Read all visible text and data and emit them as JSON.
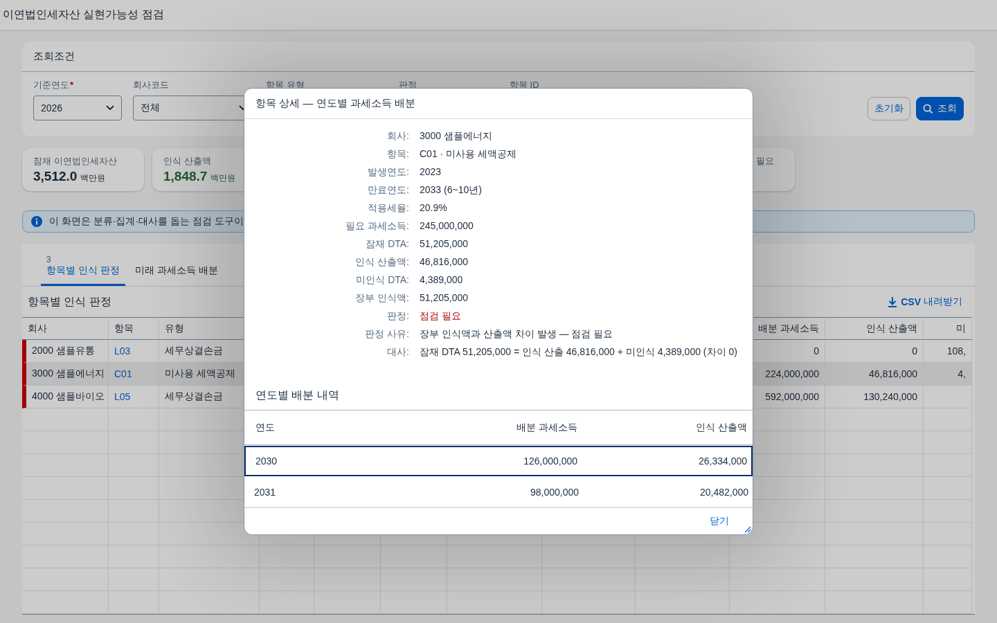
{
  "page_title": "이연법인세자산 실현가능성 점검",
  "filter_panel": {
    "title": "조회조건",
    "required_mark": "*",
    "fields": [
      {
        "label": "기준연도",
        "required": true,
        "value": "2026"
      },
      {
        "label": "회사코드",
        "required": false,
        "value": "전체"
      },
      {
        "label": "항목 유형",
        "required": false
      },
      {
        "label": "판정",
        "required": false
      },
      {
        "label": "항목 ID",
        "required": false
      }
    ],
    "buttons": [
      {
        "label": "초기화",
        "kind": "secondary"
      },
      {
        "label": "조회",
        "kind": "primary"
      }
    ]
  },
  "kpi_cards": [
    {
      "label": "잠재 이연법인세자산",
      "value": "3,512.0",
      "unit": "백만원",
      "kind": "neutral"
    },
    {
      "label": "인식 산출액",
      "value": "1,848.7",
      "unit": "백만원",
      "kind": "positive"
    },
    {
      "label": "필요",
      "kind": "clipped"
    }
  ],
  "info_banner": "이 화면은 분류·집계·대사를 돕는 점검 도구이",
  "tabs": [
    {
      "count": "3",
      "label": "항목별 인식 판정",
      "selected": true
    },
    {
      "label": "미래 과세소득 배분",
      "selected": false
    }
  ],
  "table": {
    "title": "항목별 인식 판정",
    "download_link": "CSV 내려받기",
    "columns": {
      "company": "회사",
      "item": "항목",
      "type": "유형",
      "allocated_income": "배분 과세소득",
      "recognized_amount": "인식 산출액",
      "column_12": "미"
    },
    "rows": [
      {
        "company": "2000 샘플유통",
        "item": "L03",
        "type": "세무상결손금",
        "allocated_income": "0",
        "recognized_amount": "0",
        "column_12": "108,",
        "flagged": true,
        "selected": false
      },
      {
        "company": "3000 샘플에너지",
        "item": "C01",
        "type": "미사용 세액공제",
        "allocated_income": "224,000,000",
        "recognized_amount": "46,816,000",
        "column_12": "4,",
        "flagged": true,
        "selected": true
      },
      {
        "company": "4000 샘플바이오",
        "item": "L05",
        "type": "세무상결손금",
        "allocated_income": "592,000,000",
        "recognized_amount": "130,240,000",
        "flagged": true,
        "selected": false
      }
    ]
  },
  "dialog": {
    "title": "항목 상세 — 연도별 과세소득 배분",
    "details": [
      {
        "label": "회사:",
        "value": "3000 샘플에너지",
        "kind": "text"
      },
      {
        "label": "항목:",
        "value": "C01 · 미사용 세액공제",
        "kind": "text"
      },
      {
        "label": "발생연도:",
        "value": "2023",
        "kind": "text"
      },
      {
        "label": "만료연도:",
        "value": "2033 (6~10년)",
        "kind": "text"
      },
      {
        "label": "적용세율:",
        "value": "20.9%",
        "kind": "text"
      },
      {
        "label": "필요 과세소득:",
        "value": "245,000,000",
        "kind": "text"
      },
      {
        "label": "잠재 DTA:",
        "value": "51,205,000",
        "kind": "text"
      },
      {
        "label": "인식 산출액:",
        "value": "46,816,000",
        "kind": "text"
      },
      {
        "label": "미인식 DTA:",
        "value": "4,389,000",
        "kind": "text"
      },
      {
        "label": "장부 인식액:",
        "value": "51,205,000",
        "kind": "text"
      },
      {
        "label": "판정:",
        "value": "점검 필요",
        "kind": "alert"
      },
      {
        "label": "판정 사유:",
        "value": "장부 인식액과 산출액 차이 발생 — 점검 필요",
        "kind": "text"
      },
      {
        "label": "대사:",
        "value": "잠재 DTA 51,205,000 = 인식 산출 46,816,000 + 미인식 4,389,000 (차이 0)",
        "kind": "text"
      }
    ],
    "allocation_title": "연도별 배분 내역",
    "allocation_columns": [
      "연도",
      "배분 과세소득",
      "인식 산출액"
    ],
    "allocation_rows": [
      {
        "cells": [
          "2030",
          "126,000,000",
          "26,334,000"
        ],
        "selected": true
      },
      {
        "cells": [
          "2031",
          "98,000,000",
          "20,482,000"
        ],
        "selected": false
      }
    ],
    "close_button": "닫기"
  }
}
